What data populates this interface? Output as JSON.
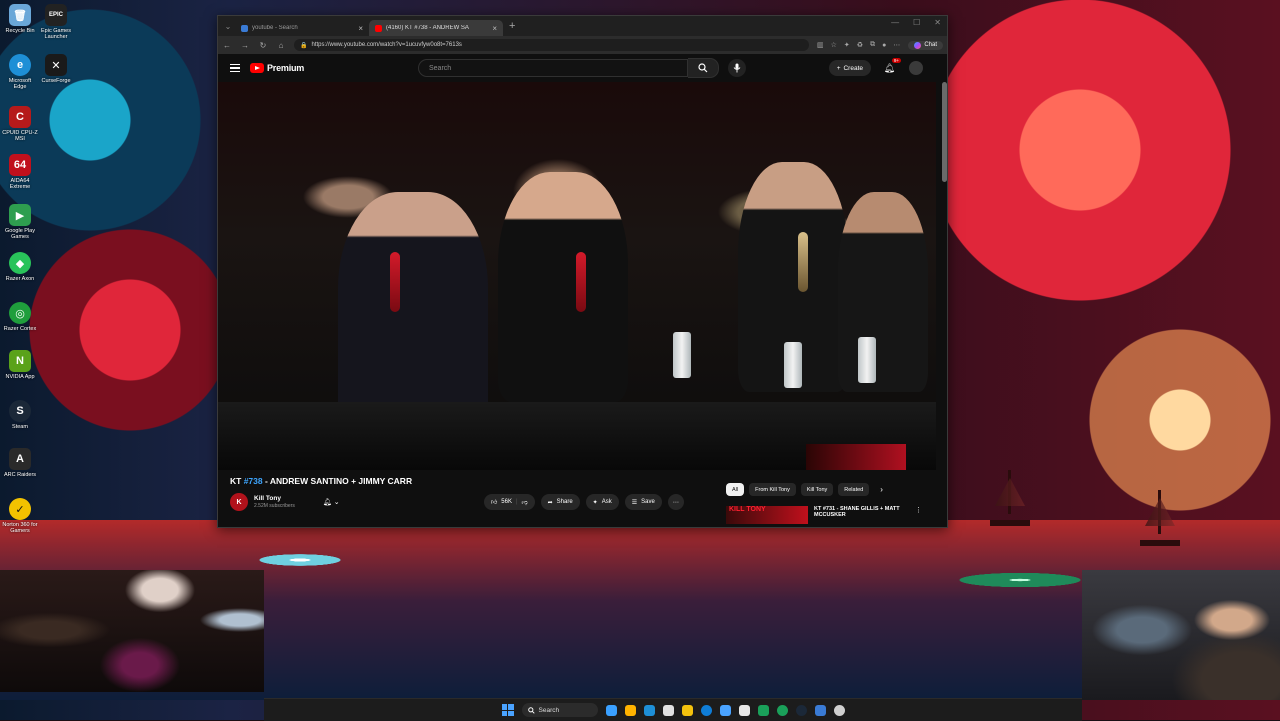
{
  "desktop": {
    "icons": [
      {
        "label": "Recycle Bin",
        "glyph": "🗑",
        "color": "#6aa7d8"
      },
      {
        "label": "Epic Games Launcher",
        "glyph": "EPIC",
        "color": "#222222"
      },
      {
        "label": "Microsoft Edge",
        "glyph": "e",
        "color": "#1e8fd6"
      },
      {
        "label": "CurseForge",
        "glyph": "✕",
        "color": "#1a1a1a"
      },
      {
        "label": "CPUID CPU-Z MSI",
        "glyph": "C",
        "color": "#b51a1a"
      },
      {
        "label": "AIDA64 Extreme",
        "glyph": "64",
        "color": "#c0101c"
      },
      {
        "label": "Google Play Games",
        "glyph": "▶",
        "color": "#2e9e4f"
      },
      {
        "label": "Razer Axon",
        "glyph": "◆",
        "color": "#29c35a"
      },
      {
        "label": "Razer Cortex",
        "glyph": "◎",
        "color": "#1f9e3c"
      },
      {
        "label": "NVIDIA App",
        "glyph": "N",
        "color": "#5aa21a"
      },
      {
        "label": "Steam",
        "glyph": "S",
        "color": "#1b2838"
      },
      {
        "label": "ARC Raiders",
        "glyph": "A",
        "color": "#2a2a2a"
      },
      {
        "label": "Norton 360 for Gamers",
        "glyph": "✓",
        "color": "#f2c200"
      }
    ]
  },
  "browser": {
    "tabs": [
      {
        "title": "youtube - Search",
        "active": false,
        "fav_color": "#3a7bd5"
      },
      {
        "title": "(4160) KT #738 - ANDREW SA",
        "active": true,
        "fav_color": "#ff0000"
      }
    ],
    "url": "https://www.youtube.com/watch?v=1ucuvfyw0o8t=7613s",
    "copilot_label": "Chat"
  },
  "youtube": {
    "brand": "Premium",
    "search_placeholder": "Search",
    "create_label": "Create",
    "notif_badge": "9+",
    "video": {
      "title_prefix": "KT ",
      "title_hashtag": "#738",
      "title_rest": " - ANDREW SANTINO + JIMMY CARR",
      "channel": "Kill Tony",
      "channel_initial": "K",
      "subscribers": "2.52M subscribers",
      "likes": "56K",
      "share_label": "Share",
      "ask_label": "Ask",
      "save_label": "Save"
    },
    "chips": [
      "All",
      "From Kill Tony",
      "Kill Tony",
      "Related"
    ],
    "recommendation": {
      "thumb_text": "KILL TONY",
      "title": "KT #731 - SHANE GILLIS + MATT MCCUSKER"
    }
  },
  "taskbar": {
    "search_label": "Search",
    "apps": [
      "#3aa0ff",
      "#ffb300",
      "#1e8fd6",
      "#e0e0e0",
      "#0f7dd6",
      "#f4c20d",
      "#4aa3ff",
      "#3aa0ff",
      "#e8e8e8",
      "#1aa05a",
      "#6a6ae8",
      "#3a7bd5",
      "#d0d0d0"
    ]
  }
}
